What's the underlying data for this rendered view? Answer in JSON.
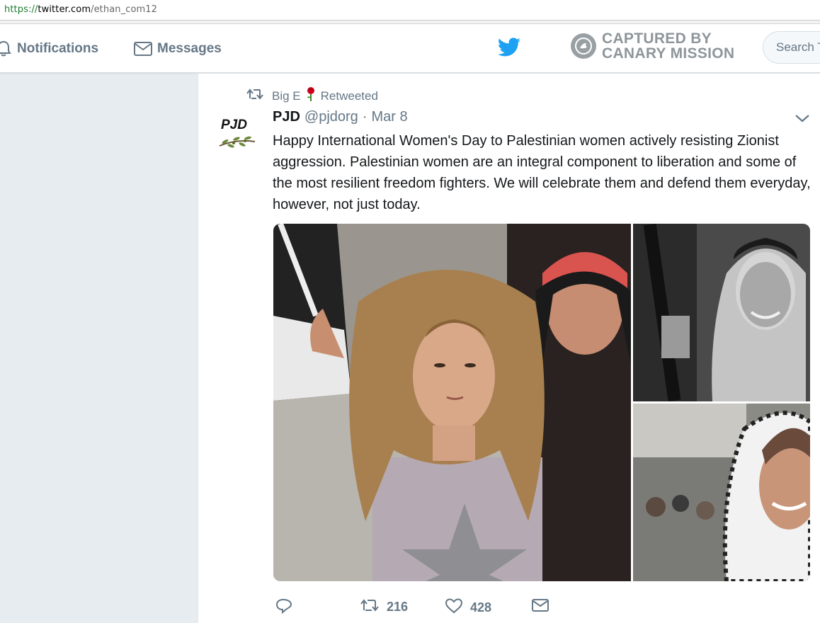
{
  "browser": {
    "url_scheme": "https://",
    "url_host": "twitter.com",
    "url_path": "/ethan_com12"
  },
  "nav": {
    "notifications_label": "Notifications",
    "messages_label": "Messages",
    "search_placeholder": "Search T",
    "watermark_line1": "CAPTURED BY",
    "watermark_line2": "CANARY MISSION"
  },
  "tweet": {
    "retweeted_by": "Big E",
    "retweeted_label": "Retweeted",
    "avatar_text": "PJD",
    "author_name": "PJD",
    "author_handle": "@pjdorg",
    "separator": "·",
    "date": "Mar 8",
    "text": "Happy International Women's Day to Palestinian women actively resisting Zionist aggression. Palestinian women are an integral component to liberation and some of the most resilient freedom fighters. We will celebrate them and defend them everyday, however, not just today.",
    "retweet_count": "216",
    "like_count": "428"
  },
  "colors": {
    "twitter_blue": "#1da1f2",
    "secondary_text": "#657786",
    "page_bg": "#e6ecf0"
  }
}
